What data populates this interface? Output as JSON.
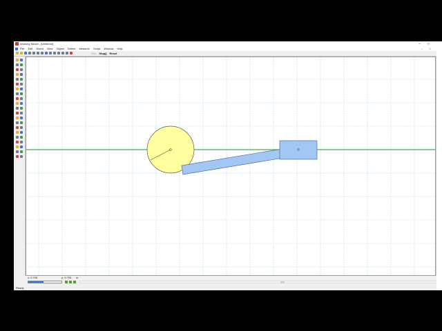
{
  "window": {
    "title": "Working Model - [Untitled2]"
  },
  "menu": [
    "File",
    "Edit",
    "World",
    "View",
    "Object",
    "Define",
    "Measure",
    "Script",
    "Window",
    "Help"
  ],
  "window_controls": {
    "minimize": "–",
    "maximize": "□",
    "close": "×"
  },
  "toolbar": {
    "run_label": "Run",
    "stop_label": "Stop||",
    "reset_label": "Reset"
  },
  "coords": {
    "x_field": "x: 0.793",
    "y_field": "y: 0.793",
    "extra": "m"
  },
  "tape": {
    "progress": 0.45
  },
  "statusbar": {
    "text": "Ready"
  },
  "colors": {
    "wheel": "#ffff9f",
    "rod": "#a3c7f5",
    "ground_line": "#3bb24a",
    "grid": "#9fd8d8"
  },
  "icons": {
    "vertex_marker": "circle-center-icon",
    "block_marker": "circle-center-icon"
  }
}
